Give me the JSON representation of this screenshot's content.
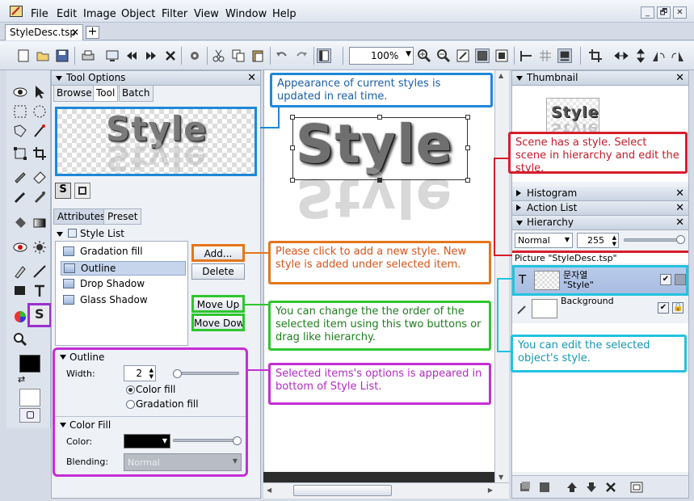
{
  "menu": [
    "File",
    "Edit",
    "Image",
    "Object",
    "Filter",
    "View",
    "Window",
    "Help"
  ],
  "window_controls": {
    "minimize": "_",
    "restore": "🗗",
    "close": "✕"
  },
  "doc_tab": {
    "title": "StyleDesc.tsp",
    "close": "✕",
    "new": "+"
  },
  "toolbar": {
    "zoom": "100%"
  },
  "tool_options": {
    "title": "Tool Options",
    "tabs": [
      "Browse",
      "Tool",
      "Batch"
    ],
    "active_tab": "Tool",
    "preview_text": "Style",
    "attr_tabs": [
      "Attributes",
      "Preset"
    ],
    "style_list_title": "Style List",
    "style_items": [
      "Gradation fill",
      "Outline",
      "Drop Shadow",
      "Glass Shadow"
    ],
    "selected_item": "Outline",
    "buttons": {
      "add": "Add...",
      "delete": "Delete",
      "move_up": "Move Up",
      "move_down": "Move Down"
    },
    "outline": {
      "title": "Outline",
      "width_label": "Width:",
      "width_value": "2",
      "radio_color": "Color fill",
      "radio_gradation": "Gradation fill"
    },
    "color_fill": {
      "title": "Color Fill",
      "color_label": "Color:",
      "blending_label": "Blending:",
      "blending_value": "Normal"
    }
  },
  "canvas": {
    "text": "Style"
  },
  "callouts": {
    "realtime": "Appearance of current styles is updated in real time.",
    "add_style": "Please click to add a new style. New style is added under selected item.",
    "reorder": "You can change the the order of the selected item using this two buttons or drag like hierarchy.",
    "options": "Selected items's options is appeared in bottom of Style List.",
    "scene": "Scene has a style. Select scene in hierarchy and edit the style.",
    "edit_object": "You can edit the selected object's style."
  },
  "right": {
    "thumbnail_title": "Thumbnail",
    "histogram_title": "Histogram",
    "actionlist_title": "Action List",
    "hierarchy_title": "Hierarchy",
    "blend_mode": "Normal",
    "opacity": "255",
    "picture_label": "Picture \"StyleDesc.tsp\"",
    "layer1_name": "문자열",
    "layer1_sub": "\"Style\"",
    "layer2_name": "Background",
    "thumb_text": "Style"
  },
  "colors": {
    "blue": "#1e88d8",
    "red": "#d61e2c",
    "orange": "#e4761b",
    "green": "#2fc52f",
    "magenta": "#c52ed4",
    "cyan": "#22c3de"
  }
}
